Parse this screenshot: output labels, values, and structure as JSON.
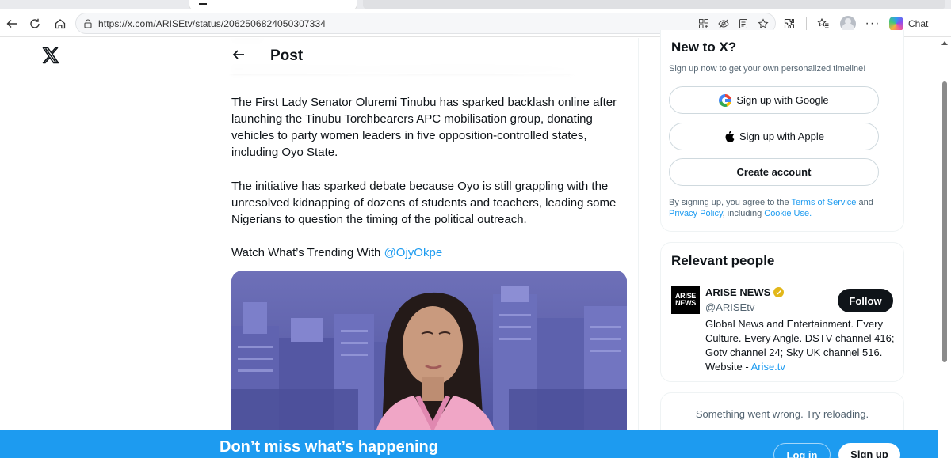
{
  "browser": {
    "url": "https://x.com/ARISEtv/status/2062506824050307334",
    "chat_label": "Chat"
  },
  "post": {
    "header_title": "Post",
    "paragraphs": [
      "The First Lady Senator Oluremi Tinubu has sparked backlash online after launching the Tinubu Torchbearers APC mobilisation group, donating vehicles to party women leaders in five opposition-controlled states, including Oyo State.",
      "The initiative has sparked debate because Oyo is still grappling with the unresolved kidnapping of dozens of students and teachers, leading some Nigerians to question the timing of the political outreach."
    ],
    "watch_prefix": "Watch What’s Trending With ",
    "watch_mention": "@OjyOkpe"
  },
  "signup_card": {
    "title": "New to X?",
    "subtitle": "Sign up now to get your own personalized timeline!",
    "google_label": "Sign up with Google",
    "apple_label": "Sign up with Apple",
    "create_label": "Create account",
    "legal_1": "By signing up, you agree to the ",
    "terms": "Terms of Service",
    "legal_2": " and ",
    "privacy": "Privacy Policy",
    "legal_3": ", including ",
    "cookie": "Cookie Use.",
    "legal_4": ""
  },
  "relevant": {
    "title": "Relevant people",
    "logo_line1": "ARISE",
    "logo_line2": "NEWS",
    "name": "ARISE NEWS",
    "handle": "@ARISEtv",
    "follow_label": "Follow",
    "bio": "Global News and Entertainment. Every Culture. Every Angle. DSTV channel 416; Gotv channel 24; Sky UK channel 516. Website - ",
    "bio_link": "Arise.tv"
  },
  "error_card": {
    "message": "Something went wrong. Try reloading."
  },
  "bottom_bar": {
    "message": "Don’t miss what’s happening",
    "login_label": "Log in",
    "signup_label": "Sign up"
  },
  "colors": {
    "accent": "#1d9bf0",
    "verified_gold": "#e2b719",
    "text_primary": "#0f1419",
    "text_secondary": "#536471"
  }
}
